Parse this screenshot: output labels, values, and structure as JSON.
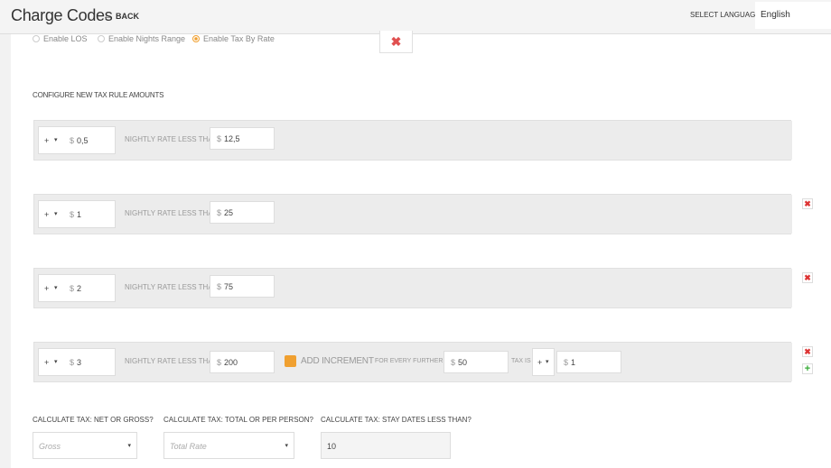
{
  "header": {
    "title": "Charge Codes",
    "back_label": "BACK",
    "back_icon": "←",
    "language_label": "SELECT LANGUAGE",
    "language_value": "English"
  },
  "options": [
    {
      "label": "Enable LOS",
      "checked": false
    },
    {
      "label": "Enable Nights Range",
      "checked": false
    },
    {
      "label": "Enable Tax By Rate",
      "checked": true
    }
  ],
  "close_icon": "✖",
  "section_title": "CONFIGURE NEW TAX RULE AMOUNTS",
  "rules": [
    {
      "op": "+",
      "op_caret": "▾",
      "currency": "$",
      "amount": "0,5",
      "label": "NIGHTLY RATE LESS THAN",
      "rate_currency": "$",
      "rate": "12,5"
    },
    {
      "op": "+",
      "op_caret": "▾",
      "currency": "$",
      "amount": "1",
      "label": "NIGHTLY RATE LESS THAN",
      "rate_currency": "$",
      "rate": "25"
    },
    {
      "op": "+",
      "op_caret": "▾",
      "currency": "$",
      "amount": "2",
      "label": "NIGHTLY RATE LESS THAN",
      "rate_currency": "$",
      "rate": "75"
    },
    {
      "op": "+",
      "op_caret": "▾",
      "currency": "$",
      "amount": "3",
      "label": "NIGHTLY RATE LESS THAN",
      "rate_currency": "$",
      "rate": "200"
    }
  ],
  "increment": {
    "label": "ADD INCREMENT",
    "every_label": "FOR EVERY FURTHER",
    "every_currency": "$",
    "every_value": "50",
    "tax_is_label": "TAX IS",
    "tax_op": "+",
    "tax_op_caret": "▾",
    "tax_currency": "$",
    "tax_value": "1"
  },
  "delete_icon": "✖",
  "add_icon": "+",
  "calc": {
    "net_gross_label": "CALCULATE TAX: NET OR GROSS?",
    "net_gross_value": "Gross",
    "total_label": "CALCULATE TAX: TOTAL OR PER PERSON?",
    "total_value": "Total Rate",
    "stay_label": "CALCULATE TAX: STAY DATES LESS THAN?",
    "stay_value": "10",
    "caret": "▾"
  }
}
